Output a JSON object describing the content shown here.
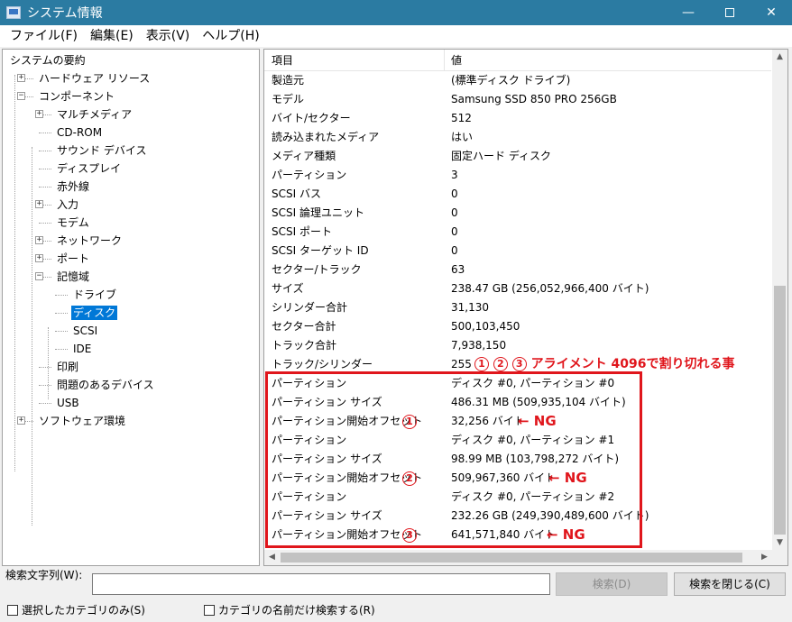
{
  "window": {
    "title": "システム情報"
  },
  "menu": [
    "ファイル(F)",
    "編集(E)",
    "表示(V)",
    "ヘルプ(H)"
  ],
  "tree": [
    {
      "label": "システムの要約",
      "depth": 0,
      "expander": ""
    },
    {
      "label": "ハードウェア リソース",
      "depth": 1,
      "expander": "+"
    },
    {
      "label": "コンポーネント",
      "depth": 1,
      "expander": "-"
    },
    {
      "label": "マルチメディア",
      "depth": 2,
      "expander": "+"
    },
    {
      "label": "CD-ROM",
      "depth": 2,
      "expander": ""
    },
    {
      "label": "サウンド デバイス",
      "depth": 2,
      "expander": ""
    },
    {
      "label": "ディスプレイ",
      "depth": 2,
      "expander": ""
    },
    {
      "label": "赤外線",
      "depth": 2,
      "expander": ""
    },
    {
      "label": "入力",
      "depth": 2,
      "expander": "+"
    },
    {
      "label": "モデム",
      "depth": 2,
      "expander": ""
    },
    {
      "label": "ネットワーク",
      "depth": 2,
      "expander": "+"
    },
    {
      "label": "ポート",
      "depth": 2,
      "expander": "+"
    },
    {
      "label": "記憶域",
      "depth": 2,
      "expander": "-"
    },
    {
      "label": "ドライブ",
      "depth": 3,
      "expander": ""
    },
    {
      "label": "ディスク",
      "depth": 3,
      "expander": "",
      "selected": true
    },
    {
      "label": "SCSI",
      "depth": 3,
      "expander": ""
    },
    {
      "label": "IDE",
      "depth": 3,
      "expander": ""
    },
    {
      "label": "印刷",
      "depth": 2,
      "expander": ""
    },
    {
      "label": "問題のあるデバイス",
      "depth": 2,
      "expander": ""
    },
    {
      "label": "USB",
      "depth": 2,
      "expander": ""
    },
    {
      "label": "ソフトウェア環境",
      "depth": 1,
      "expander": "+"
    }
  ],
  "list": {
    "headers": {
      "item": "項目",
      "value": "値"
    },
    "rows": [
      [
        "製造元",
        "(標準ディスク ドライブ)"
      ],
      [
        "モデル",
        "Samsung SSD 850 PRO 256GB"
      ],
      [
        "バイト/セクター",
        "512"
      ],
      [
        "読み込まれたメディア",
        "はい"
      ],
      [
        "メディア種類",
        "固定ハード ディスク"
      ],
      [
        "パーティション",
        "3"
      ],
      [
        "SCSI バス",
        "0"
      ],
      [
        "SCSI 論理ユニット",
        "0"
      ],
      [
        "SCSI ポート",
        "0"
      ],
      [
        "SCSI ターゲット ID",
        "0"
      ],
      [
        "セクター/トラック",
        "63"
      ],
      [
        "サイズ",
        "238.47 GB (256,052,966,400 バイト)"
      ],
      [
        "シリンダー合計",
        "31,130"
      ],
      [
        "セクター合計",
        "500,103,450"
      ],
      [
        "トラック合計",
        "7,938,150"
      ],
      [
        "トラック/シリンダー",
        "255"
      ],
      [
        "パーティション",
        "ディスク #0, パーティション #0"
      ],
      [
        "パーティション サイズ",
        "486.31 MB (509,935,104 バイト)"
      ],
      [
        "パーティション開始オフセット",
        "32,256 バイト"
      ],
      [
        "パーティション",
        "ディスク #0, パーティション #1"
      ],
      [
        "パーティション サイズ",
        "98.99 MB (103,798,272 バイト)"
      ],
      [
        "パーティション開始オフセット",
        "509,967,360 バイト"
      ],
      [
        "パーティション",
        "ディスク #0, パーティション #2"
      ],
      [
        "パーティション サイズ",
        "232.26 GB (249,390,489,600 バイト)"
      ],
      [
        "パーティション開始オフセット",
        "641,571,840 バイト"
      ]
    ]
  },
  "annotations": {
    "headline": "アライメント 4096で割り切れる事",
    "circle_nums": [
      "1",
      "2",
      "3"
    ],
    "ng_label": "← NG"
  },
  "search": {
    "label": "検索文字列(W):",
    "value": "",
    "find_button": "検索(D)",
    "close_button": "検索を閉じる(C)",
    "check_selected": "選択したカテゴリのみ(S)",
    "check_names": "カテゴリの名前だけ検索する(R)"
  },
  "colors": {
    "titlebar": "#2b7ba2",
    "selection": "#0078d7",
    "annotation": "#e0161c"
  }
}
